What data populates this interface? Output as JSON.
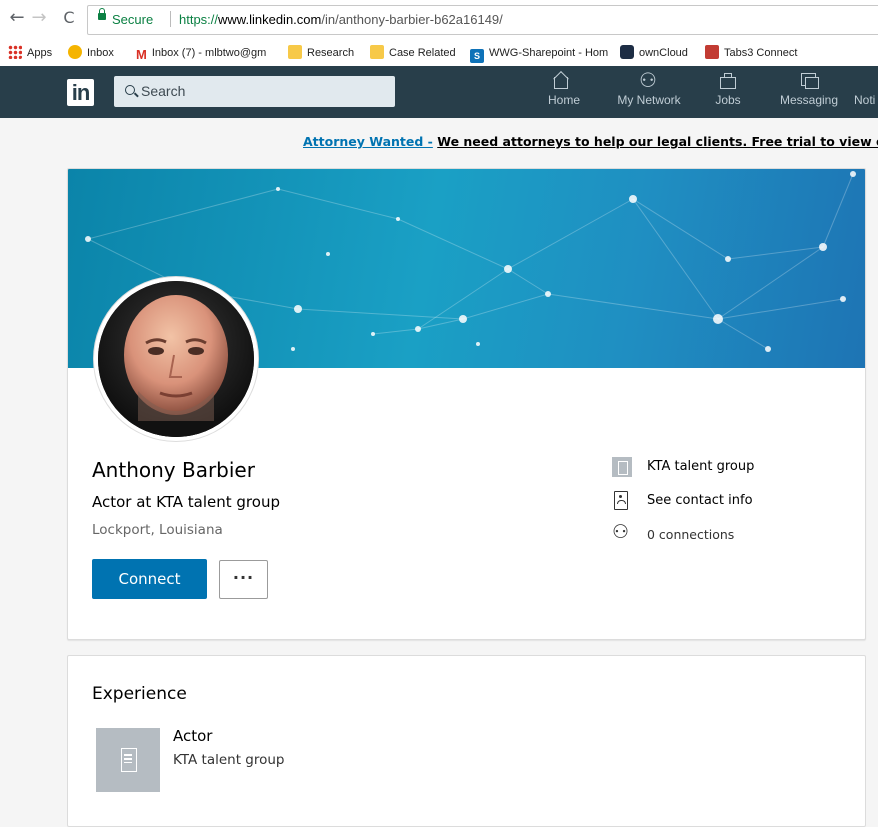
{
  "browser": {
    "secure_label": "Secure",
    "url_scheme": "https://",
    "url_host": "www.linkedin.com",
    "url_path": "/in/anthony-barbier-b62a16149/",
    "bookmarks": [
      {
        "label": "Apps",
        "icon": "apps-grid-icon"
      },
      {
        "label": "Inbox",
        "icon": "circle-icon"
      },
      {
        "label": "Inbox (7) - mlbtwo@gm",
        "icon": "gmail-icon"
      },
      {
        "label": "Research",
        "icon": "folder-icon"
      },
      {
        "label": "Case Related",
        "icon": "folder-icon"
      },
      {
        "label": "WWG-Sharepoint - Hom",
        "icon": "sharepoint-icon"
      },
      {
        "label": "ownCloud",
        "icon": "owncloud-icon"
      },
      {
        "label": "Tabs3 Connect",
        "icon": "tabs3-icon"
      }
    ]
  },
  "header": {
    "logo": "in",
    "search_placeholder": "Search",
    "nav": [
      {
        "label": "Home",
        "icon": "home-icon"
      },
      {
        "label": "My Network",
        "icon": "network-icon"
      },
      {
        "label": "Jobs",
        "icon": "briefcase-icon"
      },
      {
        "label": "Messaging",
        "icon": "messaging-icon"
      },
      {
        "label": "Noti",
        "icon": "notifications-icon"
      }
    ]
  },
  "ad": {
    "link": "Attorney Wanted -",
    "text": "We need attorneys to help our legal clients. Free trial to view c"
  },
  "profile": {
    "name": "Anthony Barbier",
    "headline": "Actor at KTA talent group",
    "location": "Lockport, Louisiana",
    "connect_label": "Connect",
    "more_label": "···",
    "company": "KTA talent group",
    "contact": "See contact info",
    "connections": "0 connections"
  },
  "experience": {
    "title": "Experience",
    "items": [
      {
        "role": "Actor",
        "company": "KTA talent group"
      }
    ]
  },
  "colors": {
    "linkedin_nav": "#283e4a",
    "primary_blue": "#0073b1",
    "secure_green": "#0b8043"
  }
}
